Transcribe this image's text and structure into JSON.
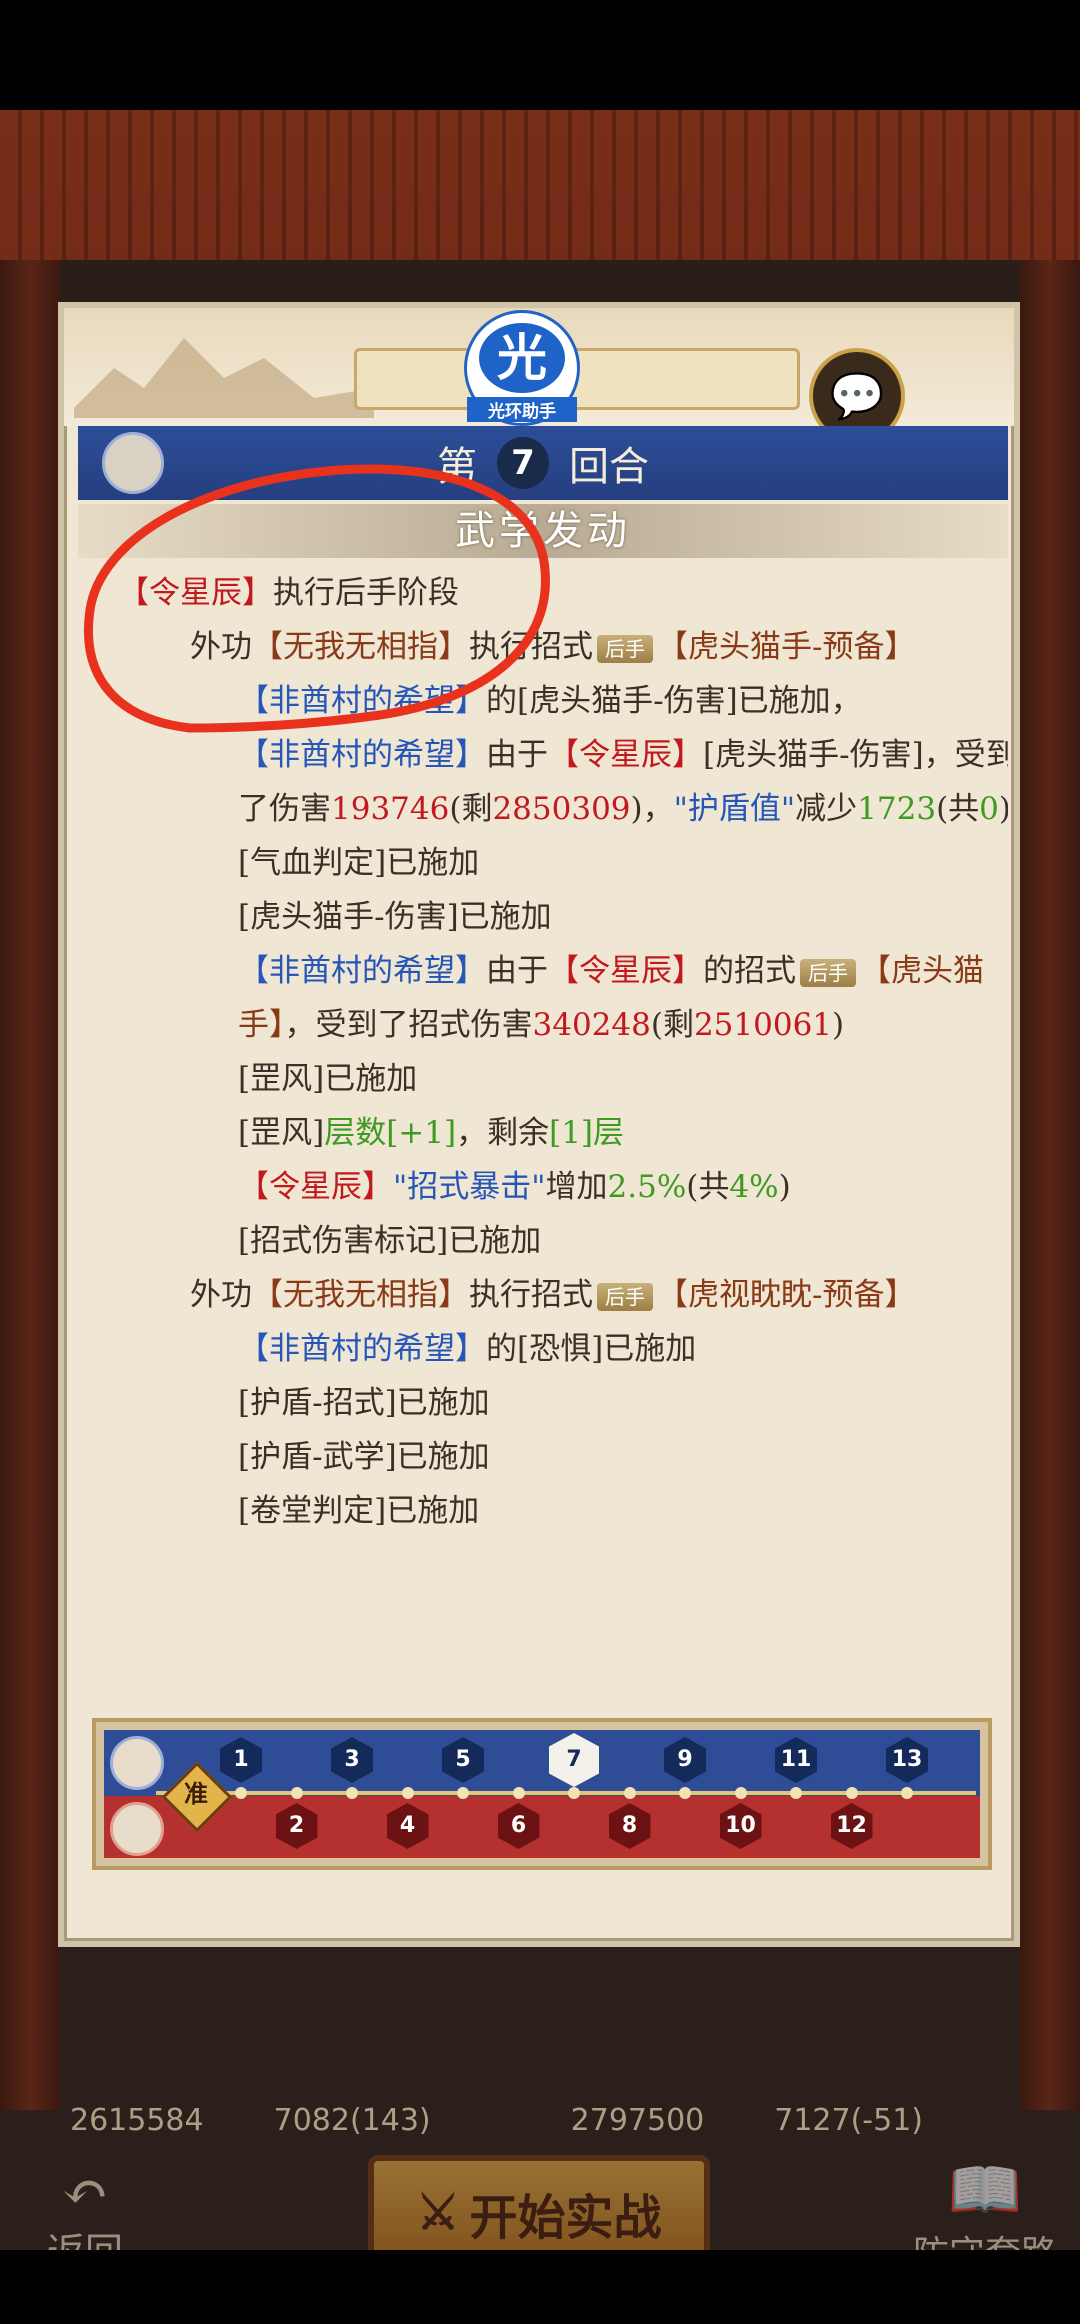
{
  "header": {
    "logo_char": "光",
    "logo_text": "光环助手",
    "round_prefix": "第",
    "round_number": "7",
    "round_suffix": "回合",
    "section_title": "武学发动"
  },
  "log": {
    "l1_name": "【令星辰】",
    "l1_text": "执行后手阶段",
    "l2_a": "外功",
    "l2_skill": "【无我无相指】",
    "l2_b": "执行招式",
    "l2_tag": "后手",
    "l2_move": "【虎头猫手-预备】",
    "l3_name": "【非酋村的希望】",
    "l3_text": "的[虎头猫手-伤害]已施加，",
    "l4_name": "【非酋村的希望】",
    "l4_a": "由于",
    "l4_src": "【令星辰】",
    "l4_b": "[虎头猫手-伤害]，受到了伤害",
    "l4_dmg": "193746",
    "l4_c": "(剩",
    "l4_rem": "2850309",
    "l4_d": ")，",
    "l4_shield": "\"护盾值\"",
    "l4_e": "减少",
    "l4_dec": "1723",
    "l4_f": "(共",
    "l4_tot": "0",
    "l4_g": ")",
    "l5": "[气血判定]已施加",
    "l6": "[虎头猫手-伤害]已施加",
    "l7_name": "【非酋村的希望】",
    "l7_a": "由于",
    "l7_src": "【令星辰】",
    "l7_b": "的招式",
    "l7_tag": "后手",
    "l7_move": "【虎头猫手】",
    "l7_c": "，受到了招式伤害",
    "l7_dmg": "340248",
    "l7_d": "(剩",
    "l7_rem": "2510061",
    "l7_e": ")",
    "l8": "[罡风]已施加",
    "l9_a": "[罡风]",
    "l9_b": "层数[+1]",
    "l9_c": "，剩余",
    "l9_d": "[1]层",
    "l10_name": "【令星辰】",
    "l10_attr": "\"招式暴击\"",
    "l10_a": "增加",
    "l10_val": "2.5%",
    "l10_b": "(共",
    "l10_tot": "4%",
    "l10_c": ")",
    "l11": "[招式伤害标记]已施加",
    "l12_a": "外功",
    "l12_skill": "【无我无相指】",
    "l12_b": "执行招式",
    "l12_tag": "后手",
    "l12_move": "【虎视眈眈-预备】",
    "l13_name": "【非酋村的希望】",
    "l13_text": "的[恐惧]已施加",
    "l14": "[护盾-招式]已施加",
    "l15": "[护盾-武学]已施加",
    "l16": "[卷堂判定]已施加"
  },
  "track": {
    "ready_label": "准",
    "blue_rounds": [
      "1",
      "3",
      "5",
      "7",
      "9",
      "11",
      "13"
    ],
    "red_rounds": [
      "2",
      "4",
      "6",
      "8",
      "10",
      "12"
    ],
    "current_round": "7"
  },
  "background": {
    "stat_1": "2615584",
    "stat_2": "7082(143)",
    "stat_3": "2797500",
    "stat_4": "7127(-51)",
    "start_button": "开始实战",
    "back_label": "返回",
    "defense_label": "防守套路"
  },
  "colors": {
    "annotation_red": "#e8321e",
    "round_bar_blue": "#2c4e98",
    "damage_red": "#c2191f",
    "name_blue": "#2556b8",
    "buff_green": "#3e9a21"
  }
}
